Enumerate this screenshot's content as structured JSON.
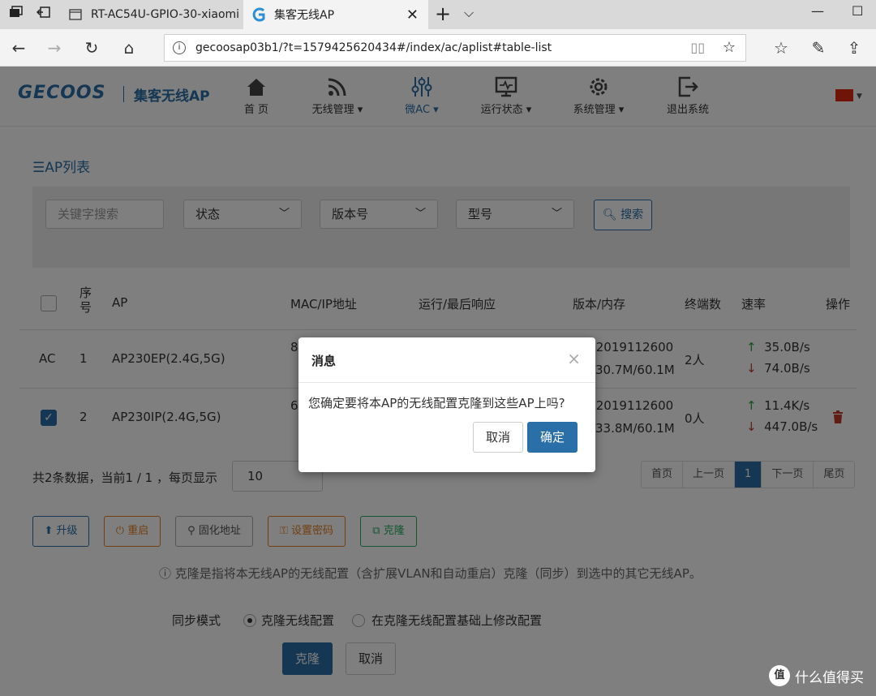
{
  "browser": {
    "tabs": [
      {
        "title": "RT-AC54U-GPIO-30-xiaomi",
        "active": false
      },
      {
        "title": "集客无线AP",
        "active": true
      }
    ],
    "address": "gecoosap03b1/?t=1579425620434#/index/ac/aplist#table-list",
    "icons": [
      "tab-manager-icon",
      "back-tab-icon",
      "back-icon",
      "forward-icon",
      "refresh-icon",
      "home-icon",
      "reading-view-icon",
      "star-icon",
      "favorites-icon",
      "pen-icon",
      "share-icon"
    ]
  },
  "header": {
    "logo": "GECOOS",
    "logo_sub": "集客无线AP",
    "menu": [
      {
        "label": "首 页",
        "icon": "home-icon"
      },
      {
        "label": "无线管理",
        "icon": "wifi-icon"
      },
      {
        "label": "微AC",
        "icon": "sliders-icon"
      },
      {
        "label": "运行状态",
        "icon": "monitor-icon"
      },
      {
        "label": "系统管理",
        "icon": "gear-icon"
      },
      {
        "label": "退出系统",
        "icon": "logout-icon"
      }
    ],
    "flag_color": "#de2910"
  },
  "content": {
    "title": "AP列表",
    "filters": {
      "keyword_placeholder": "关键字搜索",
      "status": "状态",
      "version": "版本号",
      "model": "型号",
      "search": "搜索"
    },
    "table": {
      "headers": {
        "seq": "序号",
        "ap": "AP",
        "mac": "MAC/IP地址",
        "run": "运行/最后响应",
        "ver": "版本/内存",
        "clients": "终端数",
        "rate": "速率",
        "ops": "操作"
      },
      "rows": [
        {
          "tag": "AC",
          "seq": "1",
          "ap": "AP230EP(2.4G,5G)",
          "mac_part": "8",
          "ver1": ".2019112600",
          "ver2": "30.7M/60.1M",
          "clients": "2人",
          "up": "35.0B/s",
          "down": "74.0B/s"
        },
        {
          "tag": "",
          "seq": "2",
          "ap": "AP230IP(2.4G,5G)",
          "mac_part": "6",
          "ver1": ".2019112600",
          "ver2": "33.8M/60.1M",
          "clients": "0人",
          "up": "11.4K/s",
          "down": "447.0B/s"
        }
      ]
    },
    "pagination": {
      "info": "共2条数据，当前1 / 1 ，每页显示",
      "page_size": "10",
      "first": "首页",
      "prev": "上一页",
      "current": "1",
      "next": "下一页",
      "last": "尾页"
    },
    "actions": {
      "upgrade": "升级",
      "restart": "重启",
      "fixed_addr": "固化地址",
      "set_pwd": "设置密码",
      "clone": "克隆"
    },
    "clone_hint": "克隆是指将本无线AP的无线配置（含扩展VLAN和自动重启）克隆（同步）到选中的其它无线AP。",
    "sync_mode_label": "同步模式",
    "sync_opt1": "克隆无线配置",
    "sync_opt2": "在克隆无线配置基础上修改配置",
    "clone_submit": "克隆",
    "clone_cancel": "取消"
  },
  "modal": {
    "title": "消息",
    "message": "您确定要将本AP的无线配置克隆到这些AP上吗?",
    "cancel": "取消",
    "ok": "确定"
  },
  "watermark": {
    "icon": "值",
    "text": "什么值得买"
  }
}
